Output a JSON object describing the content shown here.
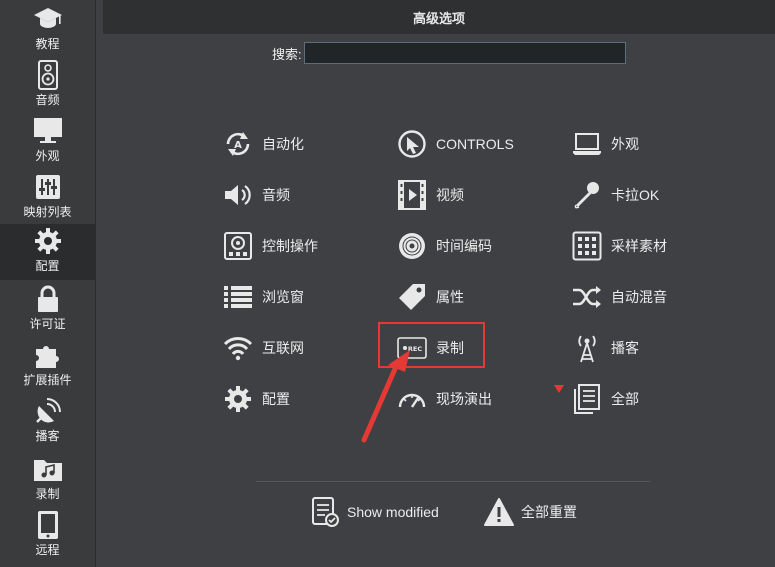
{
  "header": {
    "title": "高级选项"
  },
  "search": {
    "label": "搜索:",
    "value": "",
    "placeholder": ""
  },
  "sidebar": {
    "items": [
      {
        "label": "教程",
        "icon": "graduation-cap-icon",
        "active": false
      },
      {
        "label": "音频",
        "icon": "speaker-icon",
        "active": false
      },
      {
        "label": "外观",
        "icon": "monitor-icon",
        "active": false
      },
      {
        "label": "映射列表",
        "icon": "sliders-icon",
        "active": false
      },
      {
        "label": "配置",
        "icon": "gear-icon",
        "active": true
      },
      {
        "label": "许可证",
        "icon": "lock-icon",
        "active": false
      },
      {
        "label": "扩展插件",
        "icon": "puzzle-icon",
        "active": false
      },
      {
        "label": "播客",
        "icon": "satellite-dish-icon",
        "active": false
      },
      {
        "label": "录制",
        "icon": "music-folder-icon",
        "active": false
      },
      {
        "label": "远程",
        "icon": "tablet-icon",
        "active": false
      }
    ]
  },
  "options": {
    "col1": [
      {
        "label": "自动化",
        "icon": "automation-icon"
      },
      {
        "label": "音频",
        "icon": "volume-icon"
      },
      {
        "label": "控制操作",
        "icon": "controller-icon"
      },
      {
        "label": "浏览窗",
        "icon": "list-icon"
      },
      {
        "label": "互联网",
        "icon": "wifi-icon"
      },
      {
        "label": "配置",
        "icon": "gear-icon"
      }
    ],
    "col2": [
      {
        "label": "CONTROLS",
        "icon": "cursor-click-icon"
      },
      {
        "label": "视频",
        "icon": "film-icon"
      },
      {
        "label": "时间编码",
        "icon": "disc-icon"
      },
      {
        "label": "属性",
        "icon": "tag-icon"
      },
      {
        "label": "录制",
        "icon": "rec-icon"
      },
      {
        "label": "现场演出",
        "icon": "gauge-icon"
      }
    ],
    "col3": [
      {
        "label": "外观",
        "icon": "laptop-icon"
      },
      {
        "label": "卡拉OK",
        "icon": "microphone-icon"
      },
      {
        "label": "采样素材",
        "icon": "grid-icon"
      },
      {
        "label": "自动混音",
        "icon": "shuffle-icon"
      },
      {
        "label": "播客",
        "icon": "antenna-icon"
      },
      {
        "label": "全部",
        "icon": "document-icon"
      }
    ]
  },
  "bottom": {
    "show_modified": "Show modified",
    "reset_all": "全部重置"
  },
  "colors": {
    "accent_red": "#e53935",
    "background": "#3f4043",
    "header": "#2f3032"
  }
}
